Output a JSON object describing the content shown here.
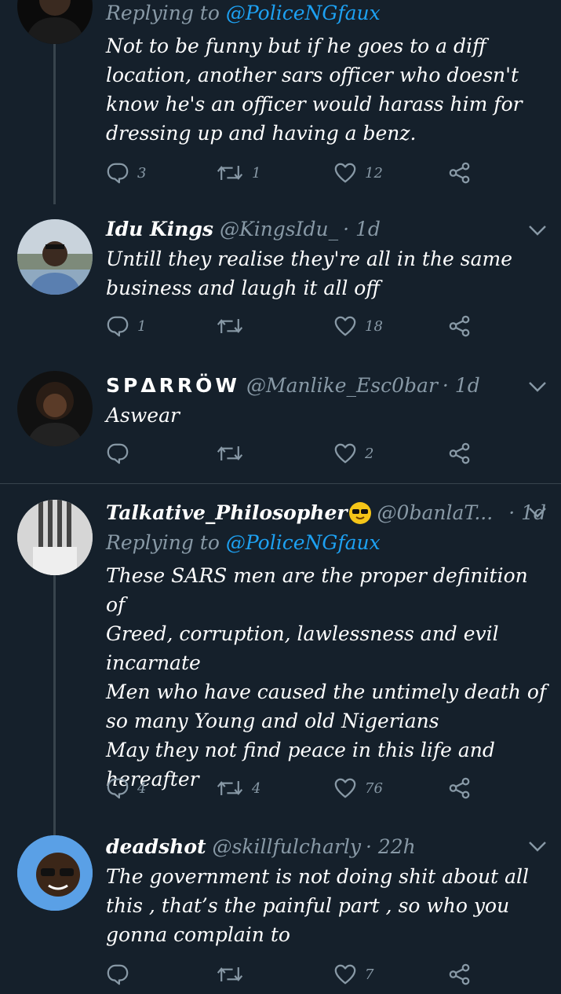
{
  "tweets": [
    {
      "id": "t0",
      "name": "",
      "handle": "",
      "time": "",
      "replying_label": "Replying to",
      "replying_handle": "@PoliceNGfaux",
      "text": "Not to be funny but if he goes to a diff\nlocation,  another sars officer who doesn't\nknow he's an officer would harass him for\ndressing up and having a benz.",
      "replies": "3",
      "retweets": "1",
      "likes": "12"
    },
    {
      "id": "t1",
      "name": "Idu Kings",
      "handle": "@KingsIdu_",
      "time": "· 1d",
      "text": "Untill they realise they're all in the same\nbusiness and laugh it all off",
      "replies": "1",
      "retweets": "",
      "likes": "18"
    },
    {
      "id": "t2",
      "name": "SPΔRRÖW",
      "handle": "@Manlike_Esc0bar",
      "time": "· 1d",
      "text": "Aswear",
      "replies": "",
      "retweets": "",
      "likes": "2"
    },
    {
      "id": "t3",
      "name": "Talkative_Philosopher",
      "handle": "@0banlaT...",
      "time": "· 1d",
      "replying_label": "Replying to",
      "replying_handle": "@PoliceNGfaux",
      "text": "These SARS men are the proper definition of\nGreed, corruption, lawlessness and evil\nincarnate\nMen who have caused the untimely death of\nso many Young and old Nigerians\nMay they not find peace in this life and\nhereafter",
      "replies": "4",
      "retweets": "4",
      "likes": "76"
    },
    {
      "id": "t4",
      "name": "deadshot",
      "handle": "@skillfulcharly",
      "time": "· 22h",
      "text": "The government is not doing shit about all\nthis , that’s the painful part , so who you\ngonna complain to",
      "replies": "",
      "retweets": "",
      "likes": "7"
    }
  ],
  "colors": {
    "background": "#15202b",
    "muted": "#8899a6",
    "link": "#1da1f2",
    "divider": "#38444d"
  },
  "icons": [
    "reply-icon",
    "retweet-icon",
    "like-icon",
    "share-icon",
    "chevron-down-icon",
    "sunglasses-emoji-icon"
  ]
}
